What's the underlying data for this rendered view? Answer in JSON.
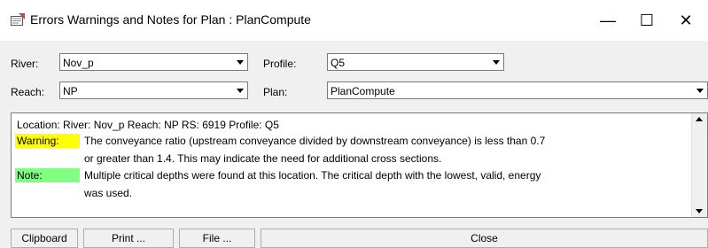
{
  "window": {
    "title": "Errors Warnings and Notes for Plan : PlanCompute",
    "minimize": "—",
    "maximize": "☐",
    "close": "✕"
  },
  "filters": {
    "river_label": "River:",
    "river_value": "Nov_p",
    "reach_label": "Reach:",
    "reach_value": "NP",
    "profile_label": "Profile:",
    "profile_value": "Q5",
    "plan_label": "Plan:",
    "plan_value": "PlanCompute"
  },
  "messages": {
    "location": "Location:  River: Nov_p  Reach: NP    RS: 6919    Profile: Q5",
    "warning_tag": "Warning:",
    "warning_line1": "The conveyance ratio (upstream conveyance divided by downstream conveyance) is less than 0.7",
    "warning_line2": "or greater than 1.4.  This may indicate the need for additional cross sections.",
    "note_tag": "Note:",
    "note_line1": "Multiple critical depths were found at this location.  The critical depth with the lowest, valid, energy",
    "note_line2": "was used."
  },
  "buttons": {
    "clipboard": "Clipboard",
    "print": "Print ...",
    "file": "File ...",
    "close": "Close"
  },
  "colors": {
    "warning_highlight": "#ffff00",
    "note_highlight": "#80ff80"
  }
}
